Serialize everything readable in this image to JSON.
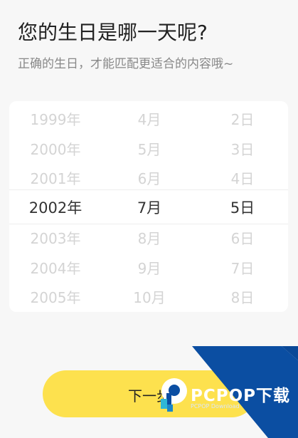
{
  "header": {
    "title": "您的生日是哪一天呢?",
    "subtitle": "正确的生日，才能匹配更适合的内容哦~"
  },
  "picker": {
    "years": [
      "1999年",
      "2000年",
      "2001年",
      "2002年",
      "2003年",
      "2004年",
      "2005年"
    ],
    "months": [
      "4月",
      "5月",
      "6月",
      "7月",
      "8月",
      "9月",
      "10月"
    ],
    "days": [
      "2日",
      "3日",
      "4日",
      "5日",
      "6日",
      "7日",
      "8日"
    ],
    "selected": {
      "year": "2002年",
      "month": "7月",
      "day": "5日"
    }
  },
  "footer": {
    "next_label": "下一步"
  },
  "watermark": {
    "brand": "PCPOP下载",
    "sub": "PCPOP Download"
  },
  "colors": {
    "button": "#fde14e",
    "watermark_blue": "#0b4ea2"
  }
}
